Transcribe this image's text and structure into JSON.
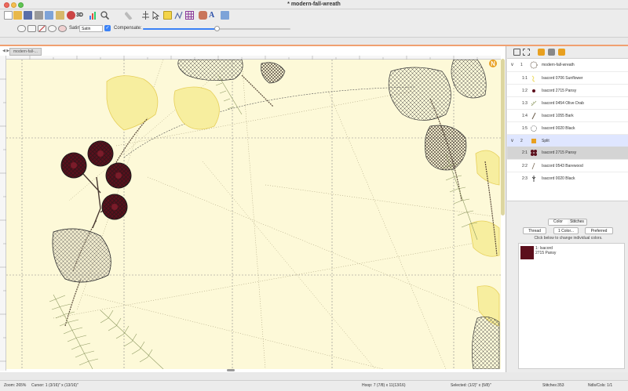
{
  "window": {
    "title": "* modern-fall-wreath"
  },
  "toolbar": {
    "icons": [
      "new-file-icon",
      "open-folder-icon",
      "save-icon",
      "print-icon",
      "copy-icon",
      "paste-icon",
      "refresh-icon",
      "3d-view-icon",
      "bar-chart-icon",
      "search-zoom-icon",
      "ruler-icon",
      "tree-icon",
      "pointer-icon",
      "template-icon",
      "stitch-editor-icon",
      "grid-icon",
      "applique-icon",
      "text-a-icon",
      "info-icon"
    ],
    "view_3d_label": "3D",
    "text_label": "A"
  },
  "toolbar2": {
    "satin_label": "Satin:",
    "satin_value": "Satin",
    "compensate_label": "Compensate:",
    "compensate_value": 0.5
  },
  "canvas": {
    "tab_label": "modern-fall-...",
    "nav_arrows": "◀ ▶",
    "compass_label": "N"
  },
  "panel": {
    "rows": [
      {
        "expander": "v",
        "num": "1",
        "label": "modern-fall-wreath",
        "icon": "wreath-icon",
        "type": "group"
      },
      {
        "num": "1:1",
        "label": "Isacord 0706 Sunflower",
        "icon": "thread-icon",
        "type": "sub"
      },
      {
        "num": "1:2",
        "label": "Isacord 2715 Pansy",
        "icon": "thread-icon",
        "type": "sub"
      },
      {
        "num": "1:3",
        "label": "Isacord 0454 Olive Drab",
        "icon": "thread-icon",
        "type": "sub"
      },
      {
        "num": "1:4",
        "label": "Isacord 1055 Bark",
        "icon": "thread-icon",
        "type": "sub"
      },
      {
        "num": "1:5",
        "label": "Isacord 0020 Black",
        "icon": "thread-icon",
        "type": "sub"
      },
      {
        "expander": "v",
        "num": "2",
        "label": "Split",
        "icon": "split-icon",
        "type": "group-highlight"
      },
      {
        "num": "2:1",
        "label": "Isacord 2715 Pansy",
        "icon": "berries-icon",
        "type": "sub-selected"
      },
      {
        "num": "2:2",
        "label": "Isacord 0543 Barewood",
        "icon": "thread-icon",
        "type": "sub"
      },
      {
        "num": "2:3",
        "label": "Isacord 0020 Black",
        "icon": "thread-icon",
        "type": "sub"
      }
    ],
    "tabs": [
      "Color",
      "Stitches"
    ],
    "active_tab": "Color",
    "buttons": {
      "thread": "Thread",
      "one_color": "1 Color...",
      "preferred": "Preferred"
    },
    "hint": "Click below to change individual colors.",
    "swatch": {
      "color": "#5c0f1c",
      "line1": "1: Isacord",
      "line2": "2715 Pansy"
    }
  },
  "status": {
    "zoom": "Zoom: 265%",
    "cursor": "Cursor: 1 (3/16)\" x (13/16)\"",
    "hoop": "Hoop: 7 (7/8) x 11(13/16)",
    "selected": "Selected: (1/2)\" x (5/8)\"",
    "stitches": "Stitches:353",
    "ndls_cols": "Ndls/Cols: 1/1"
  },
  "colors": {
    "accent": "#3b82f6",
    "canvas_bg": "#fdf9d8",
    "pansy": "#5c0f1c",
    "sunflower": "#f0de70",
    "olive": "#8f9a63",
    "bark": "#6a5a48",
    "orange_rule": "#f0a070"
  }
}
